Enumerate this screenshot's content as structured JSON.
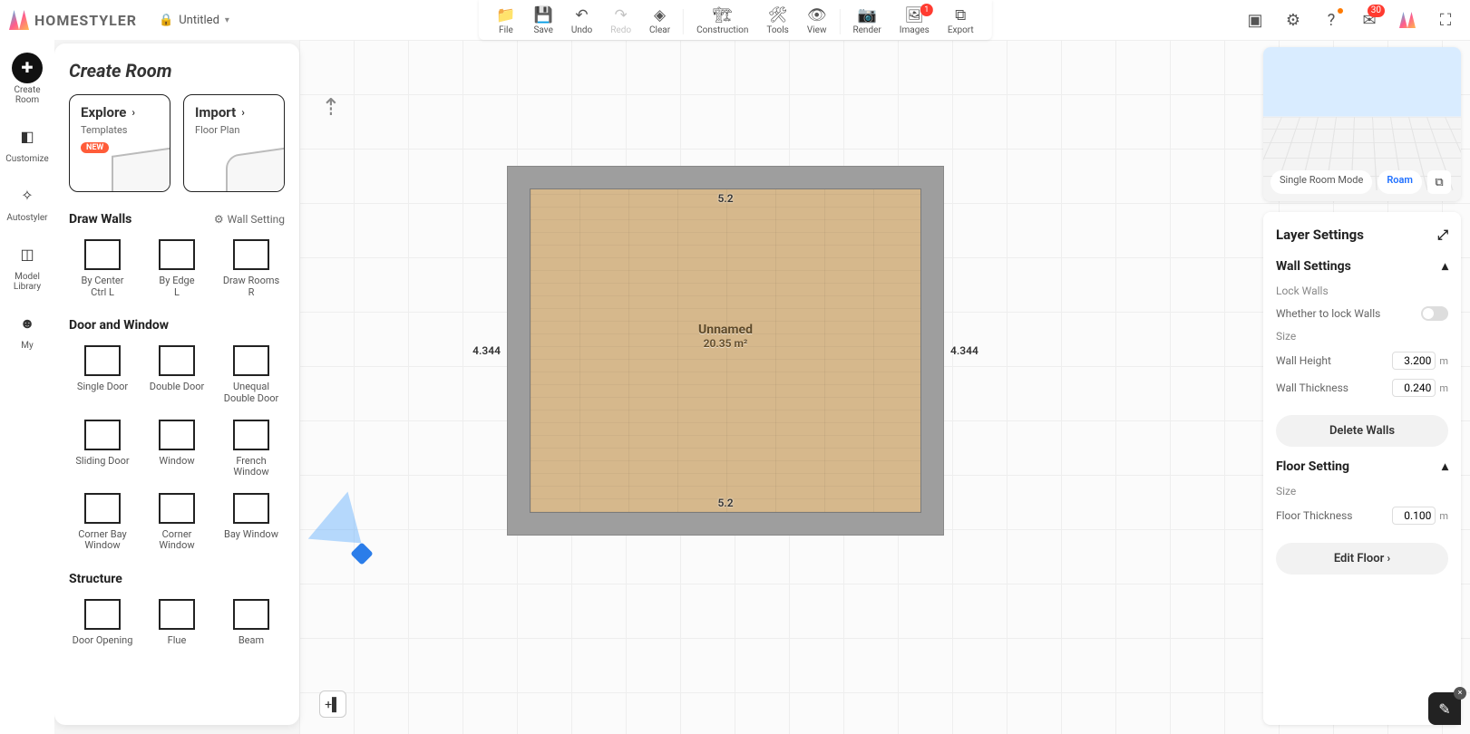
{
  "header": {
    "brand": "HOMESTYLER",
    "project_title": "Untitled",
    "tool_strip": [
      {
        "id": "file",
        "label": "File",
        "icon": "📁"
      },
      {
        "id": "save",
        "label": "Save",
        "icon": "💾"
      },
      {
        "id": "undo",
        "label": "Undo",
        "icon": "↶"
      },
      {
        "id": "redo",
        "label": "Redo",
        "icon": "↷",
        "disabled": true
      },
      {
        "id": "clear",
        "label": "Clear",
        "icon": "◈"
      },
      {
        "id": "construction",
        "label": "Construction",
        "icon": "🏗"
      },
      {
        "id": "tools",
        "label": "Tools",
        "icon": "🛠"
      },
      {
        "id": "view",
        "label": "View",
        "icon": "👁"
      },
      {
        "id": "render",
        "label": "Render",
        "icon": "📷"
      },
      {
        "id": "images",
        "label": "Images",
        "icon": "🖼",
        "badge": "1"
      },
      {
        "id": "export",
        "label": "Export",
        "icon": "⧉"
      }
    ],
    "mail_badge": "30"
  },
  "left_rail": [
    {
      "id": "create-room",
      "label": "Create Room",
      "icon": "✚",
      "active": true
    },
    {
      "id": "customize",
      "label": "Customize",
      "icon": "◧"
    },
    {
      "id": "autostyler",
      "label": "Autostyler",
      "icon": "✧"
    },
    {
      "id": "model-library",
      "label": "Model Library",
      "icon": "◫"
    },
    {
      "id": "my",
      "label": "My",
      "icon": "☻"
    }
  ],
  "side_panel": {
    "title": "Create Room",
    "explore": {
      "title": "Explore",
      "sub": "Templates",
      "badge": "NEW"
    },
    "import": {
      "title": "Import",
      "sub": "Floor Plan"
    },
    "sections": {
      "draw_walls": {
        "title": "Draw Walls",
        "link": "Wall Setting"
      },
      "door_window": {
        "title": "Door and Window"
      },
      "structure": {
        "title": "Structure"
      }
    },
    "walls": [
      {
        "label": "By Center",
        "hint": "Ctrl L"
      },
      {
        "label": "By Edge",
        "hint": "L"
      },
      {
        "label": "Draw Rooms",
        "hint": "R"
      }
    ],
    "doors": [
      {
        "label": "Single Door"
      },
      {
        "label": "Double Door"
      },
      {
        "label": "Unequal Double Door"
      },
      {
        "label": "Sliding Door"
      },
      {
        "label": "Window"
      },
      {
        "label": "French Window"
      },
      {
        "label": "Corner Bay Window"
      },
      {
        "label": "Corner Window"
      },
      {
        "label": "Bay Window"
      }
    ],
    "structure": [
      {
        "label": "Door Opening"
      },
      {
        "label": "Flue"
      },
      {
        "label": "Beam"
      }
    ]
  },
  "canvas": {
    "room_name": "Unnamed",
    "room_area": "20.35 m²",
    "dim_h": "5.2",
    "dim_v": "4.344"
  },
  "preview": {
    "mode_single": "Single Room Mode",
    "mode_roam": "Roam"
  },
  "layer_pane": {
    "title": "Layer Settings",
    "wall_section": "Wall Settings",
    "lock_walls": "Lock Walls",
    "lock_desc": "Whether to lock Walls",
    "size": "Size",
    "wall_height": "Wall Height",
    "wall_height_val": "3.200",
    "wall_thick": "Wall Thickness",
    "wall_thick_val": "0.240",
    "unit": "m",
    "delete_walls": "Delete Walls",
    "floor_section": "Floor Setting",
    "floor_thick": "Floor Thickness",
    "floor_thick_val": "0.100",
    "edit_floor": "Edit Floor"
  }
}
